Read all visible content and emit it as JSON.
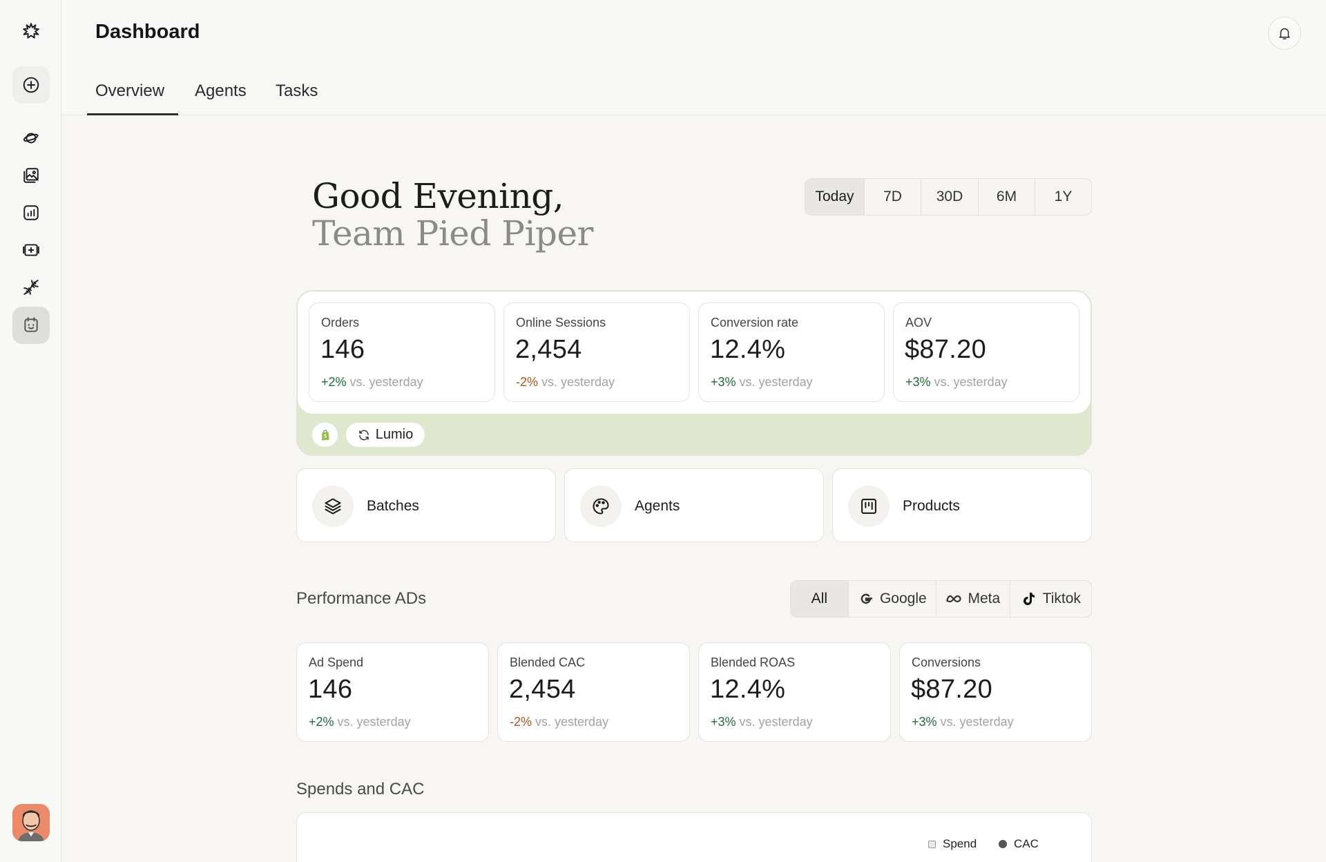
{
  "sidebar": {
    "icons": [
      "logo-icon",
      "new-icon",
      "planet-icon",
      "gallery-icon",
      "analytics-icon",
      "first-aid-icon",
      "dna-icon",
      "calendar-icon"
    ]
  },
  "header": {
    "title": "Dashboard",
    "tabs": [
      {
        "label": "Overview",
        "selected": true
      },
      {
        "label": "Agents"
      },
      {
        "label": "Tasks"
      }
    ]
  },
  "greeting": {
    "line1": "Good Evening,",
    "line2": "Team Pied Piper"
  },
  "range": {
    "options": [
      "Today",
      "7D",
      "30D",
      "6M",
      "1Y"
    ],
    "selected": "Today"
  },
  "kpis": [
    {
      "label": "Orders",
      "value": "146",
      "delta": "+2%",
      "trend": "up",
      "suffix": "vs. yesterday"
    },
    {
      "label": "Online Sessions",
      "value": "2,454",
      "delta": "-2%",
      "trend": "down",
      "suffix": "vs. yesterday"
    },
    {
      "label": "Conversion rate",
      "value": "12.4%",
      "delta": "+3%",
      "trend": "up",
      "suffix": "vs. yesterday"
    },
    {
      "label": "AOV",
      "value": "$87.20",
      "delta": "+3%",
      "trend": "up",
      "suffix": "vs. yesterday"
    }
  ],
  "sources": {
    "store_icon": "shopify-icon",
    "sync_label": "Lumio"
  },
  "shortcuts": [
    {
      "label": "Batches",
      "icon": "layers-icon"
    },
    {
      "label": "Agents",
      "icon": "palette-icon"
    },
    {
      "label": "Products",
      "icon": "kanban-icon"
    }
  ],
  "performance": {
    "title": "Performance ADs",
    "filters": [
      "All",
      "Google",
      "Meta",
      "Tiktok"
    ],
    "selected": "All",
    "cards": [
      {
        "label": "Ad Spend",
        "value": "146",
        "delta": "+2%",
        "trend": "up",
        "suffix": "vs. yesterday"
      },
      {
        "label": "Blended CAC",
        "value": "2,454",
        "delta": "-2%",
        "trend": "down",
        "suffix": "vs. yesterday"
      },
      {
        "label": "Blended ROAS",
        "value": "12.4%",
        "delta": "+3%",
        "trend": "up",
        "suffix": "vs. yesterday"
      },
      {
        "label": "Conversions",
        "value": "$87.20",
        "delta": "+3%",
        "trend": "up",
        "suffix": "vs. yesterday"
      }
    ]
  },
  "spends": {
    "title": "Spends and CAC",
    "legend": [
      "Spend",
      "CAC"
    ]
  },
  "colors": {
    "positive": "#1e6a3a",
    "negative": "#b0531c",
    "source_bar": "#dfe8cf"
  }
}
